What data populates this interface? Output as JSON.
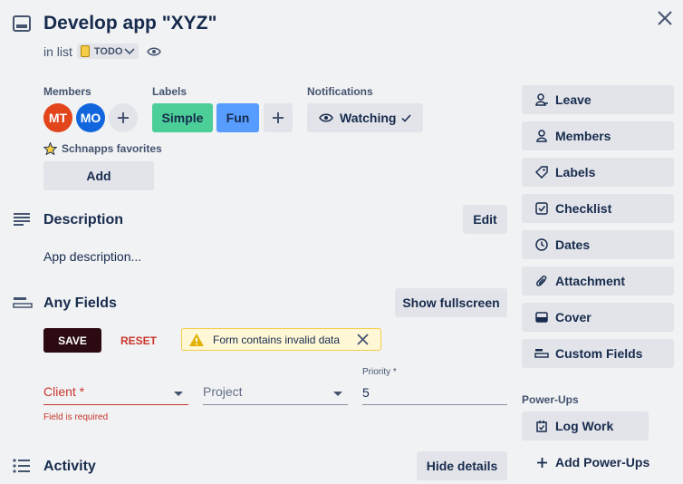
{
  "card": {
    "title": "Develop app \"XYZ\"",
    "in_list_prefix": "in list",
    "list_name": "TODO"
  },
  "members": {
    "heading": "Members",
    "avatars": [
      {
        "initials": "MT",
        "color": "#e2451b"
      },
      {
        "initials": "MO",
        "color": "#1166dd"
      }
    ]
  },
  "labels": {
    "heading": "Labels",
    "items": [
      {
        "text": "Simple",
        "color": "#4bce97"
      },
      {
        "text": "Fun",
        "color": "#579dff"
      }
    ]
  },
  "notifications": {
    "heading": "Notifications",
    "button_label": "Watching"
  },
  "favorites": {
    "label": "Schnapps favorites",
    "add_label": "Add"
  },
  "description": {
    "heading": "Description",
    "edit_label": "Edit",
    "text": "App description..."
  },
  "any_fields": {
    "heading": "Any Fields",
    "fullscreen_label": "Show fullscreen",
    "save_label": "SAVE",
    "reset_label": "RESET",
    "alert_text": "Form contains invalid data",
    "client_label": "Client *",
    "client_error": "Field is required",
    "project_label": "Project",
    "priority_label": "Priority *",
    "priority_value": "5"
  },
  "activity": {
    "heading": "Activity",
    "hide_details_label": "Hide details"
  },
  "sidebar": {
    "buttons": [
      {
        "label": "Leave",
        "icon": "leave-icon"
      },
      {
        "label": "Members",
        "icon": "person-icon"
      },
      {
        "label": "Labels",
        "icon": "tag-icon"
      },
      {
        "label": "Checklist",
        "icon": "checklist-icon"
      },
      {
        "label": "Dates",
        "icon": "clock-icon"
      },
      {
        "label": "Attachment",
        "icon": "paperclip-icon"
      },
      {
        "label": "Cover",
        "icon": "cover-icon"
      },
      {
        "label": "Custom Fields",
        "icon": "custom-fields-icon"
      }
    ],
    "powerups_heading": "Power-Ups",
    "log_work_label": "Log Work",
    "add_powerups_label": "Add Power-Ups"
  },
  "colors": {
    "accent_error": "#c9372c",
    "save_bg": "#2b0a12",
    "alert_bg": "#fff7d6",
    "alert_border": "#f5cd47"
  }
}
